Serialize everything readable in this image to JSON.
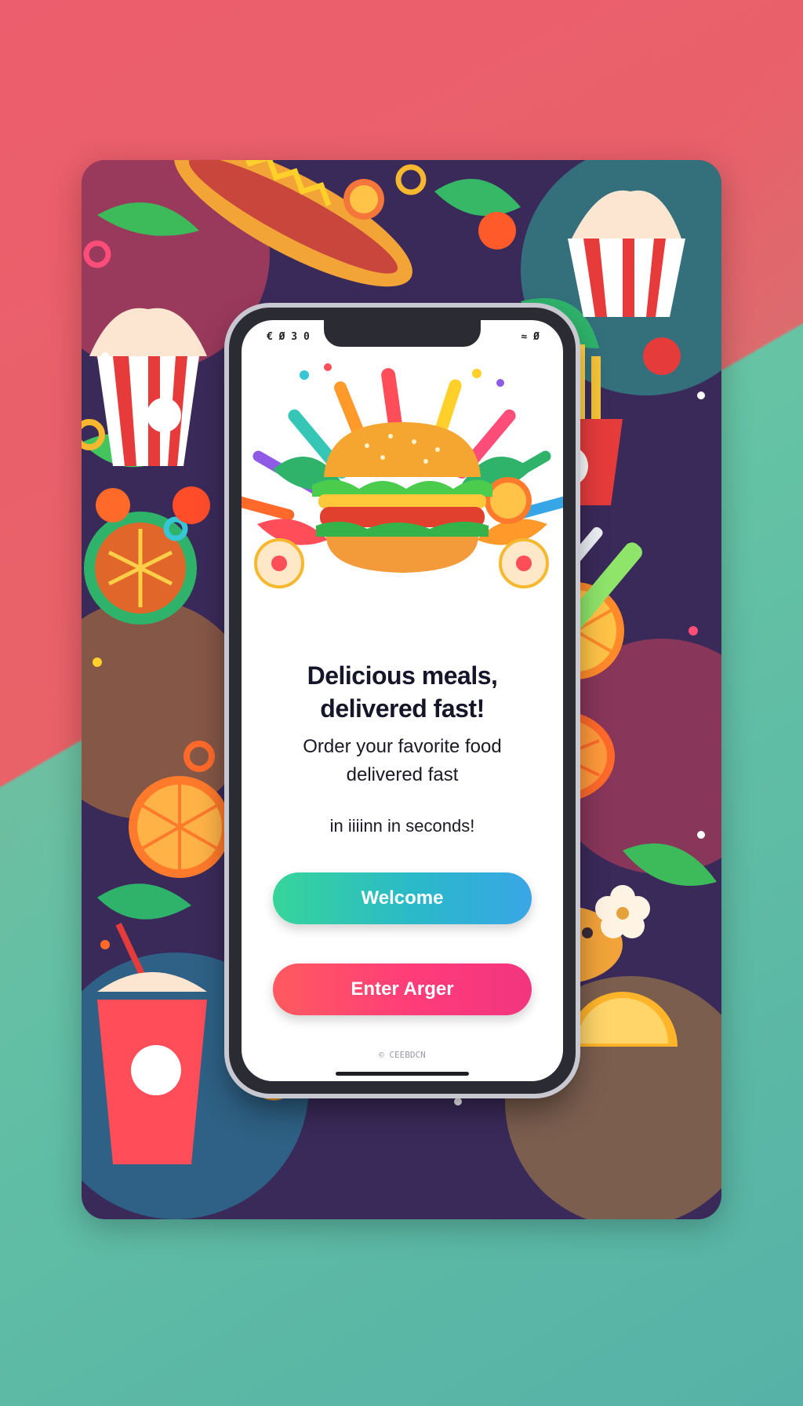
{
  "status": {
    "left": "€ Ø 3 0",
    "right": "≈ Ø"
  },
  "headline": {
    "line1": "Delicious meals,",
    "line2": "delivered fast!"
  },
  "subline": {
    "line1": "Order your favorite food",
    "line2": "delivered fast"
  },
  "subline2": "in iiiinn in seconds!",
  "buttons": {
    "welcome": "Welcome",
    "order": "Enter Arger"
  },
  "footer_mark": "© CEEBDCN",
  "colors": {
    "welcome_gradient": [
      "#36d59a",
      "#2ab9c9",
      "#39a6e6"
    ],
    "order_gradient": [
      "#ff5a5f",
      "#ff3c7a",
      "#f2357f"
    ],
    "background_top": "#e8646a",
    "background_bottom": "#56b2a6"
  },
  "icons": [
    "burger-illustration",
    "fries-icon",
    "ice-cream-cup-icon",
    "drink-cup-icon",
    "hot-dog-icon",
    "orange-slice-icon",
    "fork-knife-icon",
    "pizza-icon",
    "flower-icon"
  ]
}
